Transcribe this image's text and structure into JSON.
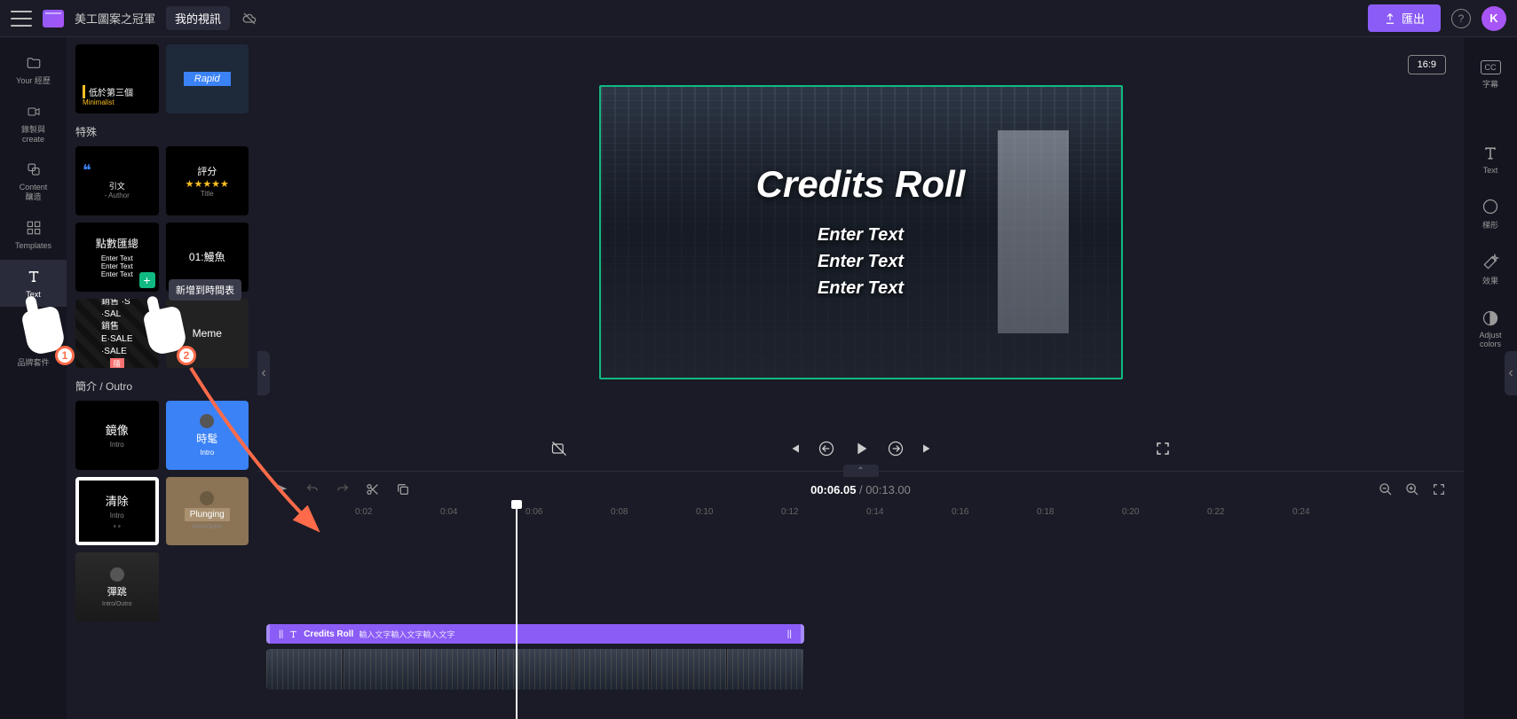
{
  "topbar": {
    "project_name": "美工圖案之冠軍",
    "project_sub": "我的視訊",
    "export_label": "匯出",
    "avatar_letter": "K"
  },
  "leftnav": {
    "items": [
      {
        "label": "Your 經歷"
      },
      {
        "label": "錄製與\ncreate"
      },
      {
        "label": "Content\n釀造"
      },
      {
        "label": "Templates"
      },
      {
        "label": "Text"
      },
      {
        "label": "品牌套件"
      }
    ]
  },
  "assets": {
    "lower3": {
      "title": "低於第三個",
      "sub": "Minimalist"
    },
    "rapid": "Rapid",
    "section_special": "特殊",
    "quote": {
      "text": "引文",
      "author": "- Author"
    },
    "rating": {
      "title": "評分",
      "stars": "★★★★★",
      "sub": "Title"
    },
    "summary": {
      "title": "點數匯總",
      "line": "Enter Text"
    },
    "countdown": {
      "time": "01:鰻魚"
    },
    "add_tooltip": "新增到時間表",
    "sale": {
      "text": "銷售 ·S\n·SAL\n銷售\nE·SALE\n·SALE",
      "badge": "隨"
    },
    "meme": "Meme",
    "section_intro": "簡介 / Outro",
    "mirror": {
      "title": "鏡像",
      "sub": "Intro"
    },
    "hour": {
      "title": "時髦",
      "sub": "Intro"
    },
    "clear": {
      "title": "清除",
      "sub": "Intro"
    },
    "plunging": {
      "title": "Plunging",
      "sub": "Intro/Outro"
    },
    "jump": {
      "title": "彈跳",
      "sub": "Intro/Outro"
    }
  },
  "preview": {
    "aspect": "16:9",
    "title": "Credits Roll",
    "line1": "Enter Text",
    "line2": "Enter Text",
    "line3": "Enter Text"
  },
  "rightnav": {
    "cc": "字幕",
    "items": [
      {
        "label": "Text"
      },
      {
        "label": "梯形"
      },
      {
        "label": "效果"
      },
      {
        "label": "Adjust\ncolors"
      }
    ]
  },
  "timeline": {
    "current": "00:06.05",
    "total": "00:13.00",
    "ticks": [
      "0:02",
      "0:04",
      "0:06",
      "0:08",
      "0:10",
      "0:12",
      "0:14",
      "0:16",
      "0:18",
      "0:20",
      "0:22",
      "0:24"
    ],
    "text_clip": {
      "title": "Credits Roll",
      "sub": "輸入文字輸入文字輸入文字"
    }
  },
  "annotation": {
    "badge1": "1",
    "badge2": "2"
  }
}
